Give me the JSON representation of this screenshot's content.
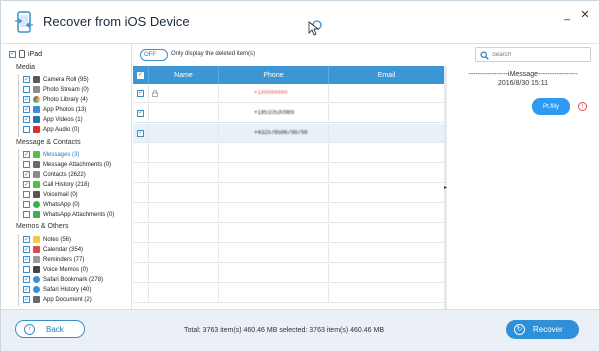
{
  "window": {
    "title": "Recover from iOS Device",
    "controls": [
      "_",
      "✕"
    ]
  },
  "device": {
    "label": "iPad",
    "checked": true
  },
  "sections": [
    {
      "title": "Media",
      "items": [
        {
          "label": "Camera Roll (95)",
          "icon": "camera-roll-icon",
          "color": "#5a5a5a",
          "checked": true
        },
        {
          "label": "Photo Stream (0)",
          "icon": "photo-stream-icon",
          "color": "#8c8c8c",
          "checked": false
        },
        {
          "label": "Photo Library (4)",
          "icon": "photo-library-icon",
          "color": "#e0543a",
          "checked": true
        },
        {
          "label": "App Photos (13)",
          "icon": "app-photos-icon",
          "color": "#3a8fd8",
          "checked": true
        },
        {
          "label": "App Videos (1)",
          "icon": "app-videos-icon",
          "color": "#2f6fb8",
          "checked": true
        },
        {
          "label": "App Audio (0)",
          "icon": "app-audio-icon",
          "color": "#d9302f",
          "checked": false
        }
      ]
    },
    {
      "title": "Message & Contacts",
      "items": [
        {
          "label": "Messages (3)",
          "icon": "messages-icon",
          "color": "#4cc24a",
          "checked": true,
          "highlight": true
        },
        {
          "label": "Message Attachments (0)",
          "icon": "message-attachments-icon",
          "color": "#6a6a6a",
          "checked": false
        },
        {
          "label": "Contacts (2622)",
          "icon": "contacts-icon",
          "color": "#8a8a8a",
          "checked": true
        },
        {
          "label": "Call History (218)",
          "icon": "call-history-icon",
          "color": "#4cc24a",
          "checked": true
        },
        {
          "label": "Voicemail (0)",
          "icon": "voicemail-icon",
          "color": "#555555",
          "checked": false
        },
        {
          "label": "WhatsApp (0)",
          "icon": "whatsapp-icon",
          "color": "#38b34a",
          "checked": false
        },
        {
          "label": "WhatsApp Attachments (0)",
          "icon": "whatsapp-attachments-icon",
          "color": "#38b34a",
          "checked": false
        }
      ]
    },
    {
      "title": "Memos & Others",
      "items": [
        {
          "label": "Notes (56)",
          "icon": "notes-icon",
          "color": "#f2c94c",
          "checked": true
        },
        {
          "label": "Calendar (354)",
          "icon": "calendar-icon",
          "color": "#e24b4b",
          "checked": true
        },
        {
          "label": "Reminders (77)",
          "icon": "reminders-icon",
          "color": "#9a9a9a",
          "checked": true
        },
        {
          "label": "Voice Memos (0)",
          "icon": "voice-memos-icon",
          "color": "#444444",
          "checked": false
        },
        {
          "label": "Safari Bookmark (278)",
          "icon": "safari-bookmark-icon",
          "color": "#3a8fd8",
          "checked": true
        },
        {
          "label": "Safari History (40)",
          "icon": "safari-history-icon",
          "color": "#3a8fd8",
          "checked": true
        },
        {
          "label": "App Document (2)",
          "icon": "app-document-icon",
          "color": "#6a6a6a",
          "checked": true
        }
      ]
    }
  ],
  "toolbar": {
    "toggle_label": "OFF",
    "filter_label": "Only display the deleted item(s)",
    "search_placeholder": "Search"
  },
  "table": {
    "headers": [
      "Name",
      "Phone",
      "Email"
    ],
    "rows": [
      {
        "name": "",
        "phone": "+1########",
        "email": "",
        "locked": true,
        "blurred": true,
        "red": true
      },
      {
        "name": "",
        "phone": "+18510530989",
        "email": "",
        "blurred": true
      },
      {
        "name": "",
        "phone": "+432576586798798",
        "email": "",
        "blurred": true,
        "selected": true
      }
    ]
  },
  "detail": {
    "title": "-----------------iMessage-----------------",
    "date": "2016/8/30 15:11",
    "bubble_text": "Pt.filly",
    "warning": "!"
  },
  "footer": {
    "back_label": "Back",
    "status": "Total: 3763 item(s) 460.46 MB    selected: 3763 item(s) 460.46 MB",
    "recover_label": "Recover"
  },
  "colors": {
    "accent": "#3c96d4",
    "button": "#2f8fd8",
    "footer_bg": "#eaf0f5",
    "bubble": "#2f9af2"
  }
}
